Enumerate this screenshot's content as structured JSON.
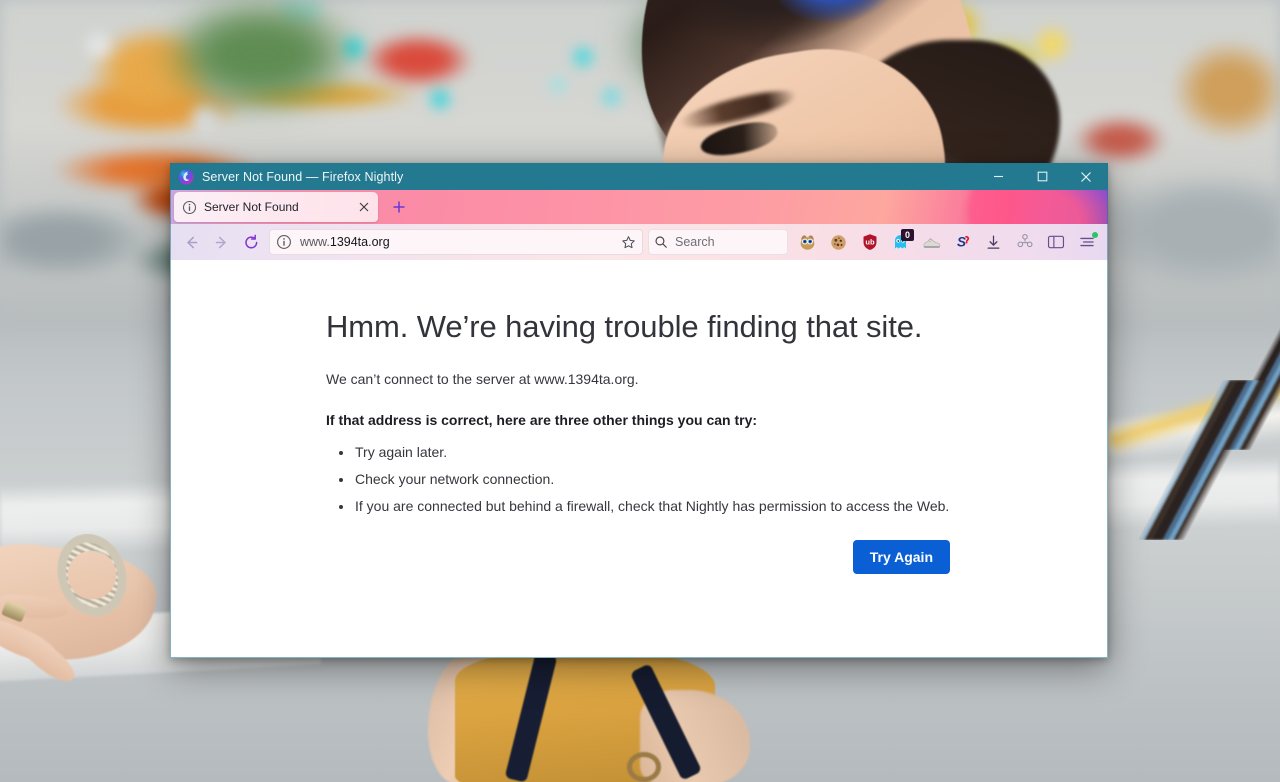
{
  "window": {
    "title": "Server Not Found — Firefox Nightly",
    "logo_icon": "firefox-nightly-logo",
    "controls": {
      "minimize": "minimize-window-button",
      "maximize": "maximize-window-button",
      "close": "close-window-button"
    }
  },
  "tabstrip": {
    "tabs": [
      {
        "label": "Server Not Found",
        "favicon": "info-circle-icon",
        "close_icon": "close-tab-icon",
        "active": true
      }
    ],
    "new_tab_label": "+"
  },
  "toolbar": {
    "back_icon": "back-arrow-icon",
    "forward_icon": "forward-arrow-icon",
    "reload_icon": "reload-icon",
    "url": {
      "identity_icon": "info-circle-icon",
      "prefix": "www.",
      "host": "1394ta.org",
      "bookmark_icon": "star-outline-icon"
    },
    "search": {
      "placeholder": "Search",
      "icon": "search-magnifier-icon"
    },
    "extensions": [
      {
        "name": "owl-extension-icon",
        "badge": ""
      },
      {
        "name": "cookie-extension-icon",
        "badge": ""
      },
      {
        "name": "ublock-origin-icon",
        "badge": ""
      },
      {
        "name": "ghostery-icon",
        "badge": "0"
      },
      {
        "name": "shoe-extension-icon",
        "badge": ""
      },
      {
        "name": "s-extension-icon",
        "badge": ""
      }
    ],
    "downloads_icon": "download-arrow-icon",
    "account_icon": "account-people-icon",
    "sidebar_icon": "sidebar-panel-icon",
    "menu_icon": "application-menu-icon"
  },
  "page": {
    "heading": "Hmm. We’re having trouble finding that site.",
    "description": "We can’t connect to the server at www.1394ta.org.",
    "subheading": "If that address is correct, here are three other things you can try:",
    "suggestions": [
      "Try again later.",
      "Check your network connection.",
      "If you are connected but behind a firewall, check that Nightly has permission to access the Web."
    ],
    "primary_button": "Try Again"
  },
  "colors": {
    "titlebar": "#23798f",
    "primary_button": "#0a5fd5",
    "badge": "#2b1230",
    "menu_dot": "#2ac36a"
  }
}
